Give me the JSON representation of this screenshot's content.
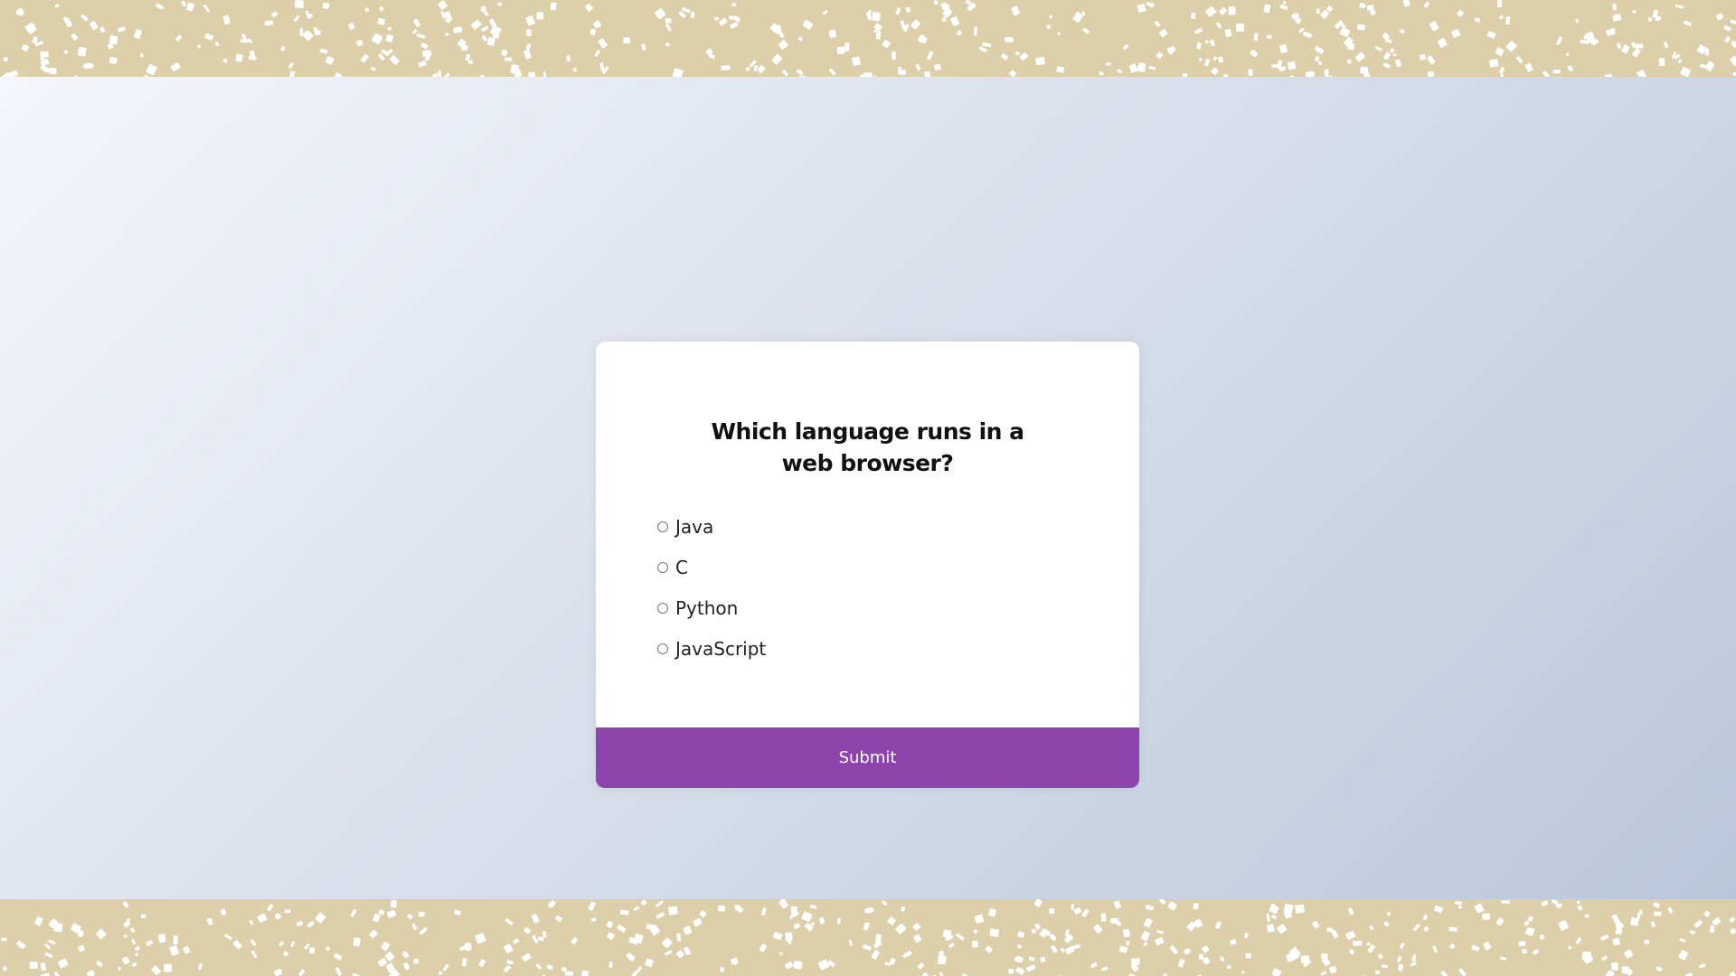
{
  "quiz": {
    "question": "Which language runs in a web browser?",
    "answers": [
      {
        "label": "Java"
      },
      {
        "label": "C"
      },
      {
        "label": "Python"
      },
      {
        "label": "JavaScript"
      }
    ],
    "submit_label": "Submit"
  },
  "colors": {
    "band": "#dccfa9",
    "button": "#8e44ad"
  }
}
